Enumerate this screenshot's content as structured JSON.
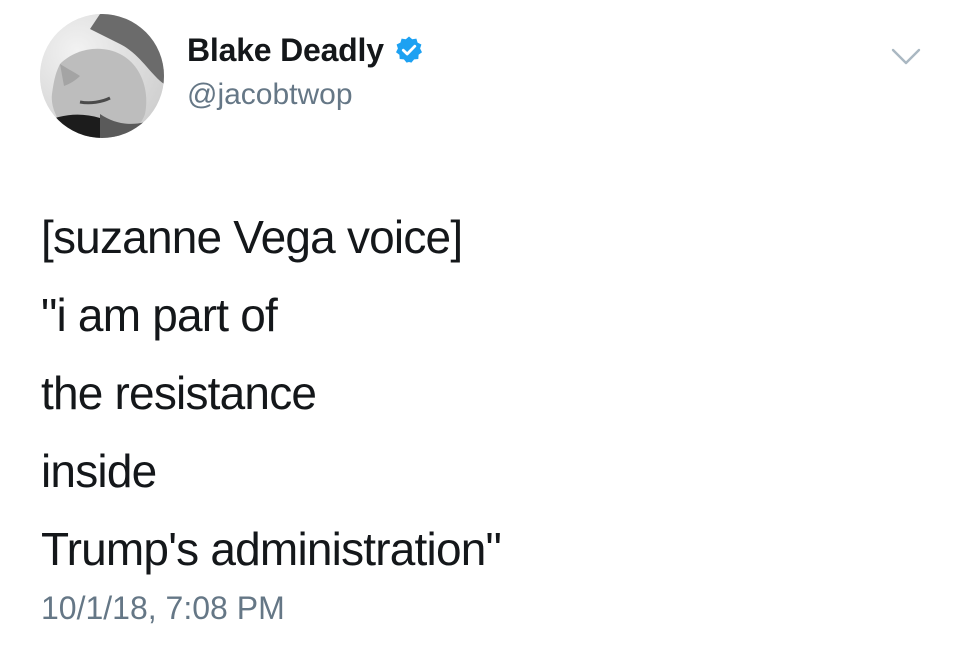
{
  "user": {
    "display_name": "Blake Deadly",
    "handle": "@jacobtwop",
    "verified": true,
    "avatar_icon": "profile-photo"
  },
  "tweet": {
    "lines": [
      "[suzanne Vega voice]",
      "\"i am part of",
      "the resistance",
      "inside",
      "Trump's administration\""
    ],
    "timestamp": "10/1/18, 7:08 PM"
  },
  "icons": {
    "verified": "verified-badge-icon",
    "menu": "chevron-down-icon"
  },
  "colors": {
    "text": "#14171a",
    "secondary": "#657786",
    "verified_blue": "#1da1f2",
    "background": "#ffffff"
  }
}
